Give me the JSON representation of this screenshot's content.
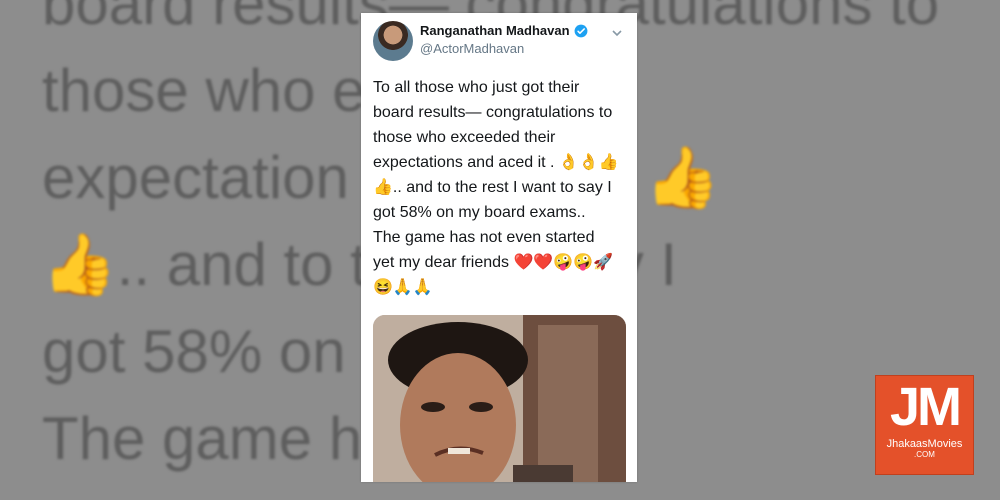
{
  "background": {
    "lines": [
      "board results— congratulations to",
      "those who e        heir",
      "expectation          d it .",
      ".. and to t         ant to say I",
      "got 58% on            exams..",
      "The game h           n started"
    ],
    "emojis": [
      "👌",
      "👌",
      "👍",
      "👍"
    ]
  },
  "tweet": {
    "display_name": "Ranganathan Madhavan",
    "handle": "@ActorMadhavan",
    "text_lines": [
      "To all those who just got their",
      "board results— congratulations to",
      "those who exceeded their",
      "expectations and aced it . 👌👌👍",
      "👍.. and to the rest I want to say I",
      "got 58% on my board exams..",
      "The game has not even started",
      "yet my dear friends ❤️❤️🤪🤪🚀",
      "😆🙏🙏"
    ]
  },
  "watermark": {
    "letters": "JM",
    "site": "JhakaasMovies",
    "tld": ".COM"
  },
  "colors": {
    "verified": "#1da1f2",
    "logo": "#e4512a"
  }
}
